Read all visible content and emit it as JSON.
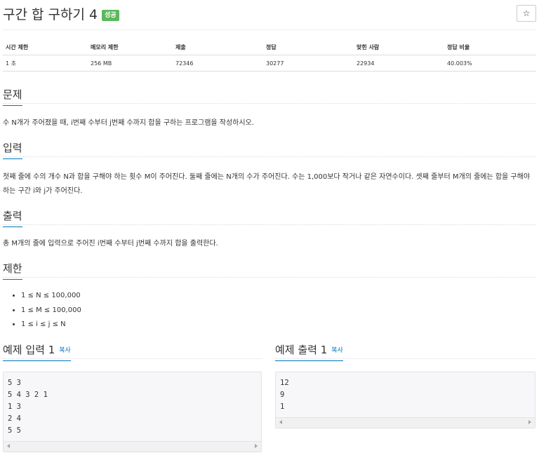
{
  "problem": {
    "title": "구간 합 구하기 4",
    "badge": "성공",
    "star_label": "☆"
  },
  "info": {
    "headers": [
      "시간 제한",
      "메모리 제한",
      "제출",
      "정답",
      "맞힌 사람",
      "정답 비율"
    ],
    "values": [
      "1 초",
      "256 MB",
      "72346",
      "30277",
      "22934",
      "40.003%"
    ]
  },
  "sections": {
    "problem_title": "문제",
    "problem_text": "수 N개가 주어졌을 때, i번째 수부터 j번째 수까지 합을 구하는 프로그램을 작성하시오.",
    "input_title": "입력",
    "input_text": "첫째 줄에 수의 개수 N과 합을 구해야 하는 횟수 M이 주어진다. 둘째 줄에는 N개의 수가 주어진다. 수는 1,000보다 작거나 같은 자연수이다. 셋째 줄부터 M개의 줄에는 합을 구해야 하는 구간 i와 j가 주어진다.",
    "output_title": "출력",
    "output_text": "총 M개의 줄에 입력으로 주어진 i번째 수부터 j번째 수까지 합을 출력한다.",
    "limit_title": "제한",
    "limits": [
      "1 ≤ N ≤ 100,000",
      "1 ≤ M ≤ 100,000",
      "1 ≤ i ≤ j ≤ N"
    ]
  },
  "examples": {
    "input_title": "예제 입력 1",
    "output_title": "예제 출력 1",
    "copy_label": "복사",
    "input_lines": [
      "5 3",
      "5 4 3 2 1",
      "1 3",
      "2 4",
      "5 5"
    ],
    "output_lines": [
      "12",
      "9",
      "1"
    ]
  },
  "colors": {
    "accent": "#0076c0",
    "badge": "#5cb85c"
  }
}
